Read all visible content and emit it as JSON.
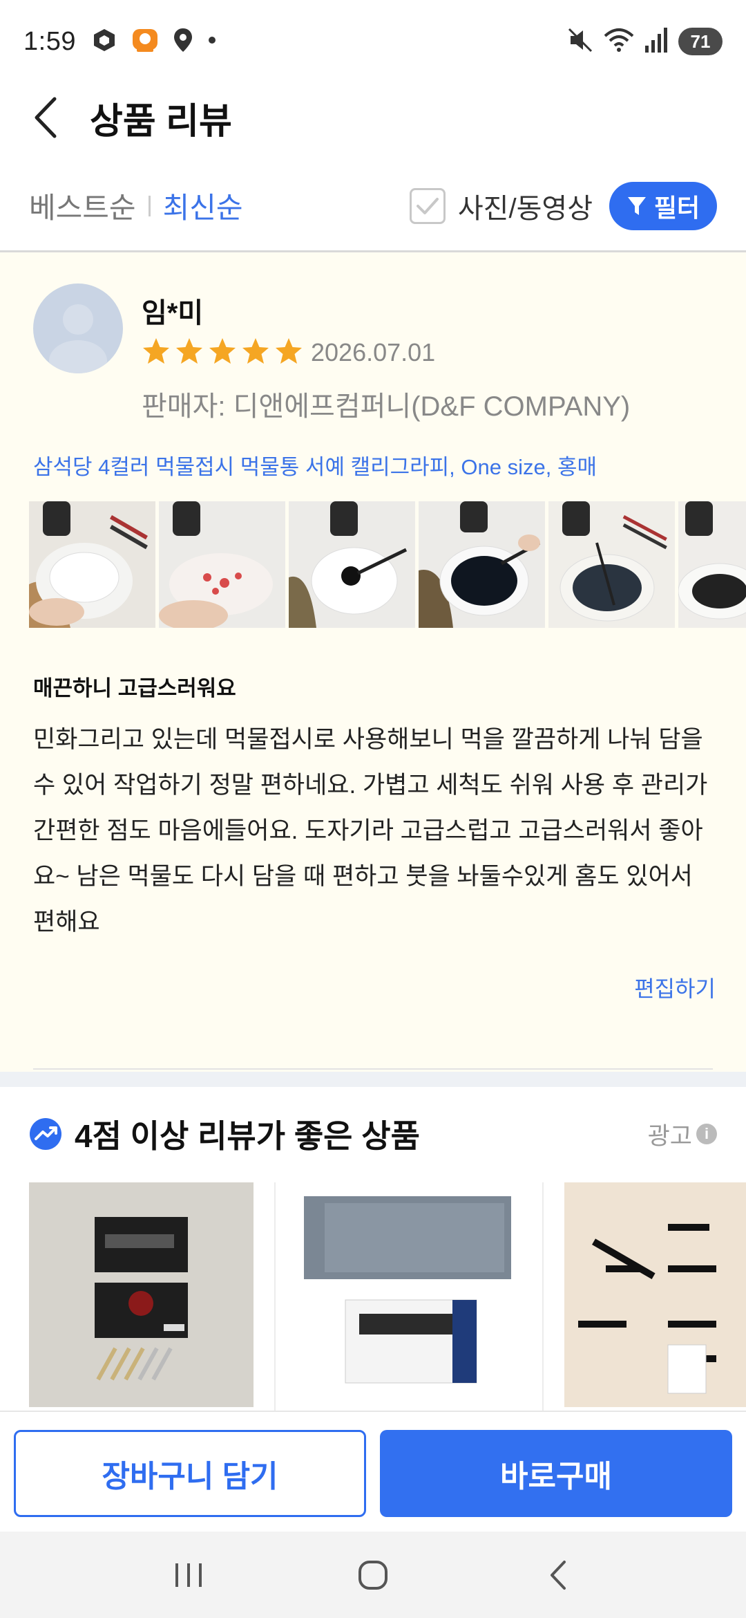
{
  "status_bar": {
    "time": "1:59",
    "battery": "71"
  },
  "header": {
    "title": "상품 리뷰"
  },
  "sort": {
    "best_label": "베스트순",
    "newest_label": "최신순",
    "photo_filter_label": "사진/동영상",
    "filter_button_label": "필터"
  },
  "review": {
    "author": "임*미",
    "rating": 5,
    "date": "2026.07.01",
    "seller": "판매자: 디앤에프컴퍼니(D&F COMPANY)",
    "product_option": "삼석당 4컬러 먹물접시 먹물통 서예 캘리그라피, One size, 홍매",
    "title": "매끈하니 고급스러워요",
    "body": "민화그리고 있는데 먹물접시로 사용해보니 먹을 깔끔하게 나눠 담을 수 있어 작업하기 정말 편하네요. 가볍고 세척도 쉬워 사용 후 관리가 간편한 점도 마음에들어요. 도자기라 고급스럽고 고급스러워서 좋아요~ 남은 먹물도 다시 담을 때 편하고 붓을 놔둘수있게 홈도 있어서 편해요",
    "edit_label": "편집하기"
  },
  "recommended": {
    "title": "4점 이상 리뷰가 좋은 상품",
    "ad_label": "광고"
  },
  "actions": {
    "cart_label": "장바구니 담기",
    "buy_label": "바로구매"
  },
  "colors": {
    "accent": "#2f6df0",
    "star": "#f5a623",
    "review_bg": "#fffdf2"
  }
}
